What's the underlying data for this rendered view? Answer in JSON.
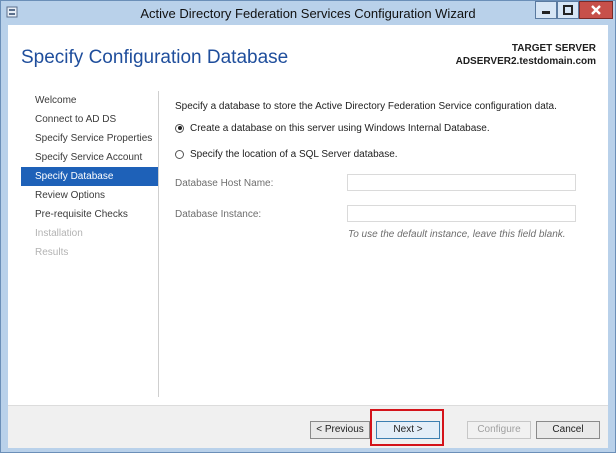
{
  "window": {
    "title": "Active Directory Federation Services Configuration Wizard"
  },
  "header": {
    "page_title": "Specify Configuration Database",
    "target_label": "TARGET SERVER",
    "target_server": "ADSERVER2.testdomain.com"
  },
  "steps": [
    {
      "label": "Welcome",
      "state": "normal"
    },
    {
      "label": "Connect to AD DS",
      "state": "normal"
    },
    {
      "label": "Specify Service Properties",
      "state": "normal"
    },
    {
      "label": "Specify Service Account",
      "state": "normal"
    },
    {
      "label": "Specify Database",
      "state": "active"
    },
    {
      "label": "Review Options",
      "state": "normal"
    },
    {
      "label": "Pre-requisite Checks",
      "state": "normal"
    },
    {
      "label": "Installation",
      "state": "disabled"
    },
    {
      "label": "Results",
      "state": "disabled"
    }
  ],
  "main": {
    "description": "Specify a database to store the Active Directory Federation Service configuration data.",
    "option_internal": "Create a database on this server using Windows Internal Database.",
    "option_sql": "Specify the location of a SQL Server database.",
    "selected_option": "internal",
    "host_label": "Database Host Name:",
    "host_value": "",
    "instance_label": "Database Instance:",
    "instance_value": "",
    "hint": "To use the default instance, leave this field blank."
  },
  "footer": {
    "previous_label": "< Previous",
    "next_label": "Next >",
    "configure_label": "Configure",
    "cancel_label": "Cancel"
  },
  "colors": {
    "title_blue": "#1f4e9c",
    "active_step": "#1e61b8",
    "highlight_red": "#d4131a"
  },
  "icons": {
    "app": "server-manager-icon",
    "minimize": "minimize-icon",
    "maximize": "maximize-icon",
    "close": "close-icon"
  }
}
